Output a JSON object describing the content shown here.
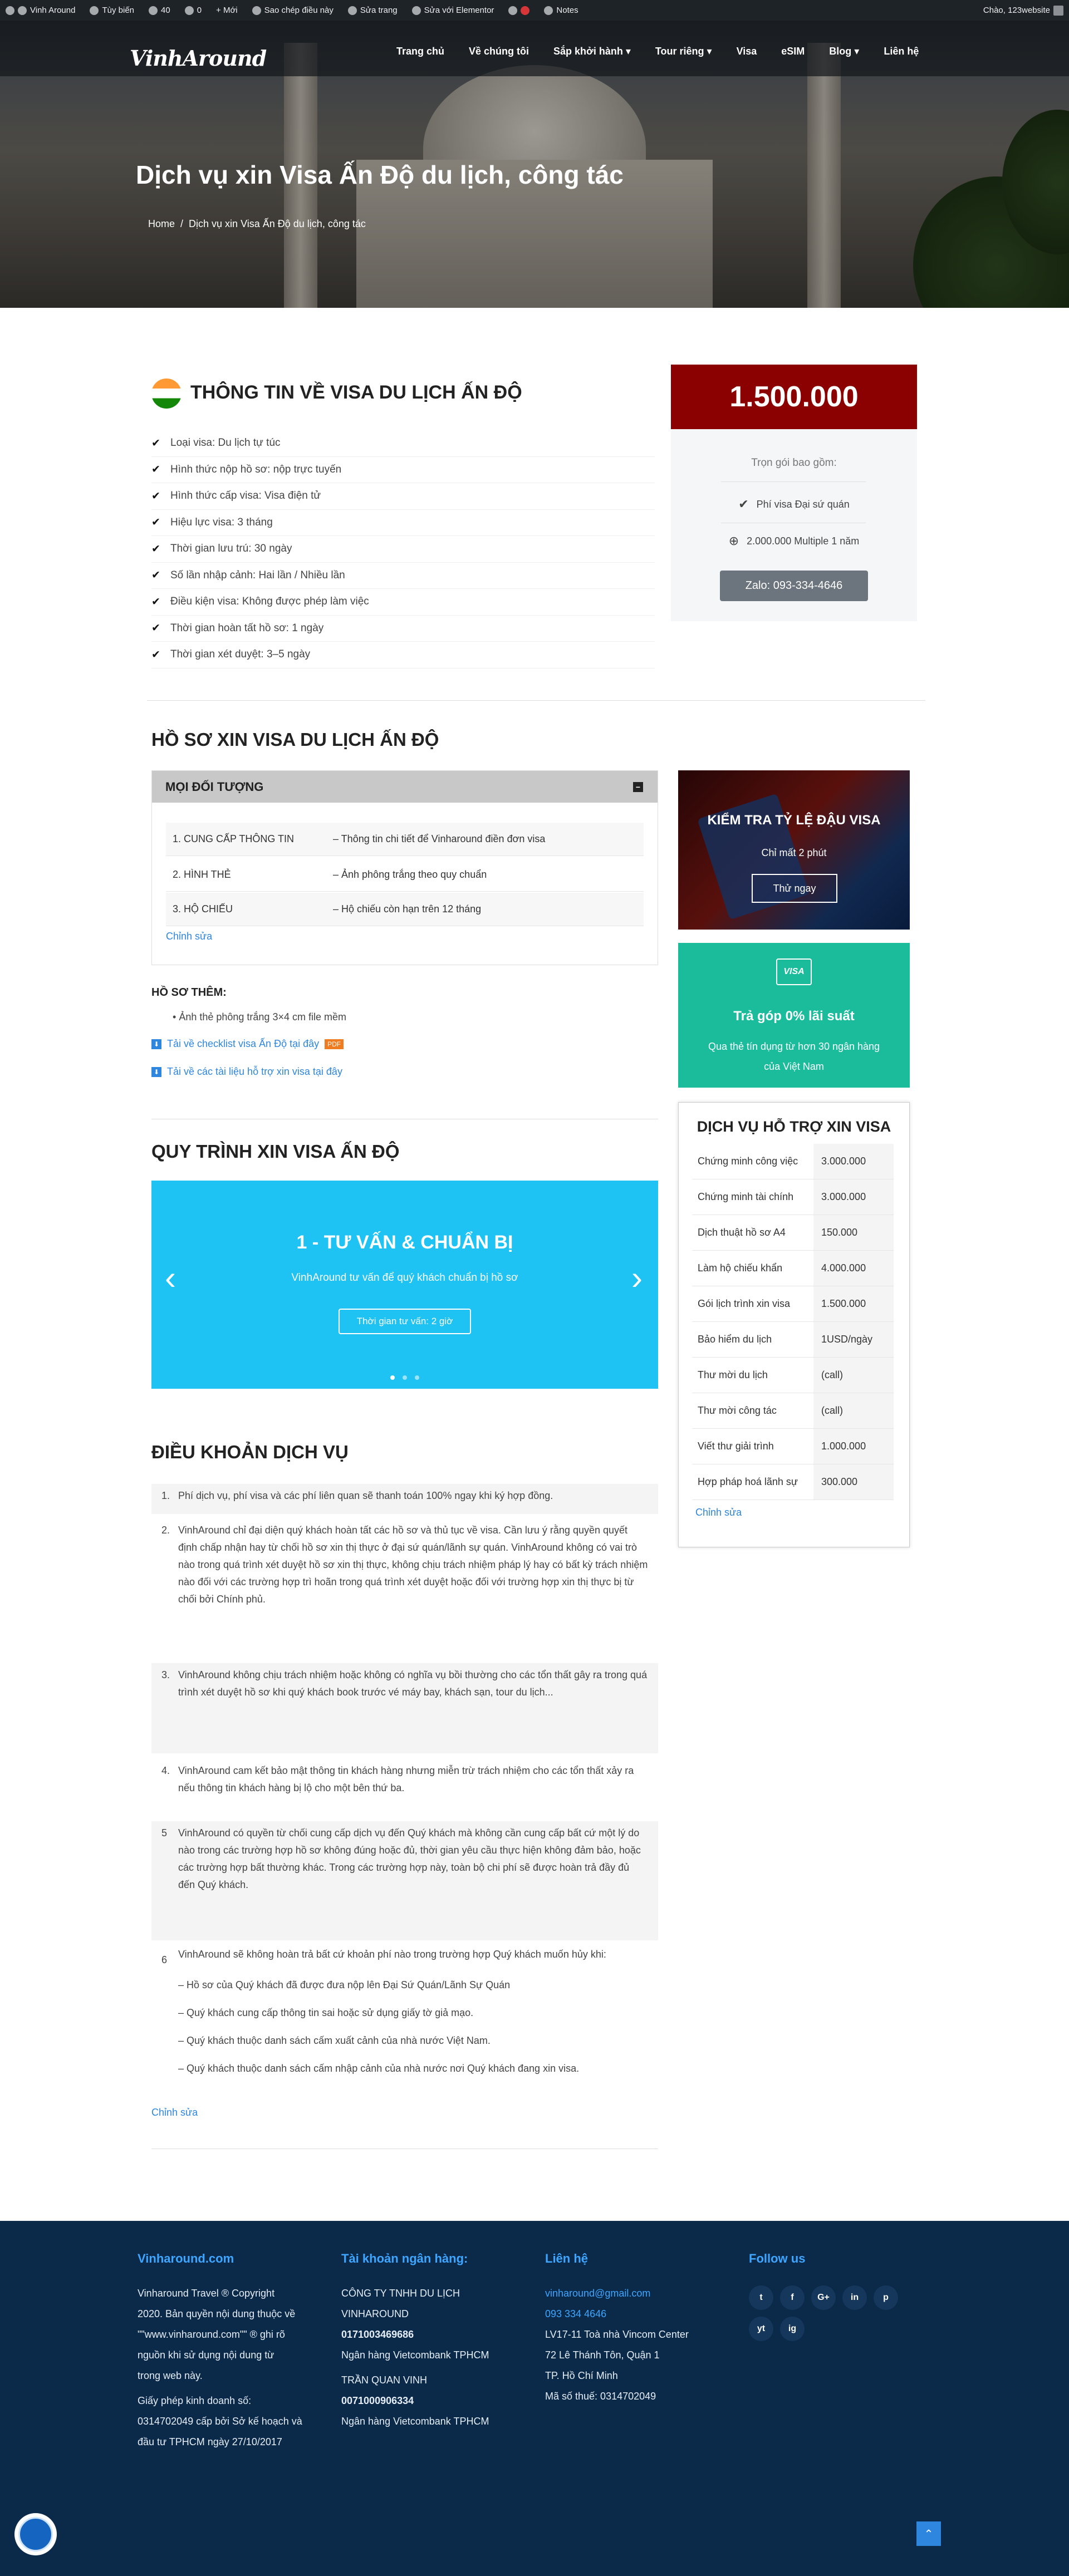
{
  "adminbar": {
    "items": [
      "Vinh Around",
      "Tùy biến",
      "40",
      "0",
      "+ Mới",
      "Sao chép điều này",
      "Sửa trang",
      "Sửa với Elementor",
      "",
      "Notes"
    ],
    "greeting": "Chào, 123website"
  },
  "header": {
    "logo": "VinhAround",
    "nav": [
      "Trang chủ",
      "Về chúng tôi",
      "Sắp khởi hành ▾",
      "Tour riêng ▾",
      "Visa",
      "eSIM",
      "Blog ▾",
      "Liên hệ"
    ],
    "title": "Dịch vụ xin Visa Ấn Độ du lịch, công tác",
    "breadcrumb": {
      "home": "Home",
      "sep": "/",
      "current": "Dịch vụ xin Visa Ấn Độ du lịch, công tác"
    }
  },
  "info": {
    "title": "THÔNG TIN VỀ VISA DU LỊCH ẤN ĐỘ",
    "items": [
      "Loại visa: Du lịch tự túc",
      "Hình thức nộp hồ sơ: nộp trực tuyến",
      "Hình thức cấp visa: Visa điện tử",
      "Hiệu lực visa: 3 tháng",
      "Thời gian lưu trú: 30 ngày",
      "Số lần nhập cảnh: Hai lần / Nhiều lần",
      "Điều kiện visa: Không được phép làm việc",
      "Thời gian hoàn tất hồ sơ: 1 ngày",
      "Thời gian xét duyệt: 3–5 ngày"
    ]
  },
  "price": {
    "amount": "1.500.000",
    "includes_label": "Trọn gói bao gồm:",
    "line1": "Phí visa Đại sứ quán",
    "line2": "2.000.000 Multiple 1 năm",
    "cta": "Zalo: 093-334-4646",
    "colors": {
      "header": "#8b0000",
      "button": "#6c757d"
    }
  },
  "profile": {
    "title": "HỒ SƠ XIN VISA DU LỊCH ẤN ĐỘ",
    "tab": "MỌI ĐỐI TƯỢNG",
    "rows": [
      {
        "name": "1. CUNG CẤP THÔNG TIN",
        "desc": "– Thông tin chi tiết để Vinharound điền đơn visa"
      },
      {
        "name": "2. HÌNH THẺ",
        "desc": "– Ảnh phông trắng theo quy chuẩn"
      },
      {
        "name": "3. HỘ CHIẾU",
        "desc": "– Hộ chiếu còn hạn trên 12 tháng"
      }
    ],
    "edit": "Chỉnh sửa",
    "extra_title": "HỒ SƠ THÊM:",
    "extra_item": "Ảnh thẻ phông trắng 3×4 cm file mềm",
    "dl1": "Tải về checklist visa Ấn Độ tại đây",
    "dl1_badge": "PDF",
    "dl2": "Tải về các tài liệu hỗ trợ xin visa tại đây"
  },
  "check": {
    "title": "KIỂM TRA TỶ LỆ ĐẬU VISA",
    "sub": "Chỉ mất 2 phút",
    "button": "Thử ngay"
  },
  "installment": {
    "logo": "VISA",
    "title": "Trả góp 0% lãi suất",
    "desc": "Qua thẻ tín dụng từ hơn 30 ngân hàng của Việt Nam"
  },
  "services": {
    "title": "DỊCH VỤ HỖ TRỢ XIN VISA",
    "rows": [
      {
        "name": "Chứng minh công việc",
        "value": "3.000.000"
      },
      {
        "name": "Chứng minh tài chính",
        "value": "3.000.000"
      },
      {
        "name": "Dịch thuật hồ sơ A4",
        "value": "150.000"
      },
      {
        "name": "Làm hộ chiếu khẩn",
        "value": "4.000.000"
      },
      {
        "name": "Gói lịch trình xin visa",
        "value": "1.500.000"
      },
      {
        "name": "Bảo hiểm du lịch",
        "value": "1USD/ngày"
      },
      {
        "name": "Thư mời du lịch",
        "value": "(call)"
      },
      {
        "name": "Thư mời công tác",
        "value": "(call)"
      },
      {
        "name": "Viết thư giải trình",
        "value": "1.000.000"
      },
      {
        "name": "Hợp pháp hoá lãnh sự",
        "value": "300.000"
      }
    ],
    "edit": "Chỉnh sửa"
  },
  "process": {
    "title": "QUY TRÌNH XIN VISA ẤN ĐỘ",
    "slide_title": "1 - TƯ VẤN & CHUẨN BỊ",
    "slide_desc": "VinhAround tư vấn để quý khách chuẩn bị hồ sơ",
    "slide_button": "Thời gian tư vấn: 2 giờ",
    "prev": "‹",
    "next": "›",
    "color": "#1ec3f4"
  },
  "terms": {
    "title": "ĐIỀU KHOẢN DỊCH VỤ",
    "items": [
      {
        "num": "1.",
        "text": "Phí dịch vụ, phí visa và các phí liên quan sẽ thanh toán 100% ngay khi ký hợp đồng."
      },
      {
        "num": "2.",
        "text": "VinhAround chỉ đại diện quý khách hoàn tất các hồ sơ và thủ tục về visa. Cần lưu ý rằng quyền quyết định chấp nhận hay từ chối hồ sơ xin thị thực ở đại sứ quán/lãnh sự quán. VinhAround không có vai trò nào trong quá trình xét duyệt hồ sơ xin thị thực, không chịu trách nhiệm pháp lý hay có bất kỳ trách nhiệm nào đối với các trường hợp trì hoãn trong quá trình xét duyệt hoặc đối với trường hợp xin thị thực bị từ chối bởi Chính phủ."
      },
      {
        "num": "3.",
        "text": "VinhAround không chịu trách nhiệm hoặc không có nghĩa vụ bồi thường cho các tổn thất gây ra trong quá trình xét duyệt hồ sơ khi quý khách book trước vé máy bay, khách sạn, tour du lịch..."
      },
      {
        "num": "4.",
        "text": "VinhAround cam kết bảo mật thông tin khách hàng nhưng miễn trừ trách nhiệm cho các tổn thất xảy ra nếu thông tin khách hàng bị lộ cho một bên thứ ba."
      },
      {
        "num": "5",
        "text": "VinhAround có quyền từ chối cung cấp dịch vụ đến Quý khách mà không cần cung cấp bất cứ một lý do nào trong các trường hợp hồ sơ không đúng hoặc đủ, thời gian yêu cầu thực hiện không đảm bảo, hoặc các trường hợp bất thường khác. Trong các trường hợp này, toàn bộ chi phí sẽ được hoàn trả đầy đủ đến Quý khách."
      },
      {
        "num": "6",
        "text": "VinhAround sẽ không hoàn trả bất cứ khoản phí nào trong trường hợp Quý khách muốn hủy khi:"
      }
    ],
    "subitems": [
      "– Hồ sơ của Quý khách đã được đưa nộp lên Đại Sứ Quán/Lãnh Sự Quán",
      "– Quý khách cung cấp thông tin sai hoặc sử dụng giấy tờ giả mạo.",
      "– Quý khách thuộc danh sách cấm xuất cảnh của nhà nước Việt Nam.",
      "– Quý khách thuộc danh sách cấm nhập cảnh của nhà nước nơi Quý khách đang xin visa."
    ],
    "edit": "Chỉnh sửa"
  },
  "footer": {
    "col1_title": "Vinharound.com",
    "col1_lines": [
      "Vinharound Travel ® Copyright",
      "2020. Bản quyền nội dung thuộc về",
      "\"\"www.vinharound.com\"\" ® ghi rõ",
      "nguồn khi sử dụng nội dung từ",
      "trong web này.",
      "Giấy phép kinh doanh số:",
      "0314702049 cấp bởi Sở kế hoạch và",
      "đầu tư TPHCM ngày 27/10/2017"
    ],
    "col2_title": "Tài khoản ngân hàng:",
    "col2_lines": [
      "CÔNG TY TNHH DU LỊCH",
      "VINHAROUND",
      "0171003469686",
      "Ngân hàng Vietcombank TPHCM",
      "TRẦN QUAN VINH",
      "0071000906334",
      "Ngân hàng Vietcombank TPHCM"
    ],
    "col3_title": "Liên hệ",
    "email": "vinharound@gmail.com",
    "phone": "093 334 4646",
    "col3_lines": [
      "LV17-11 Toà nhà Vincom Center",
      "72 Lê Thánh Tôn, Quận 1",
      "TP. Hồ Chí Minh",
      "Mã số thuế: 0314702049"
    ],
    "col4_title": "Follow us",
    "socials": [
      "t",
      "f",
      "G+",
      "in",
      "p",
      "yt",
      "ig"
    ],
    "colors": {
      "bg": "#0b2a4a",
      "accent": "#3ea6ff"
    }
  }
}
